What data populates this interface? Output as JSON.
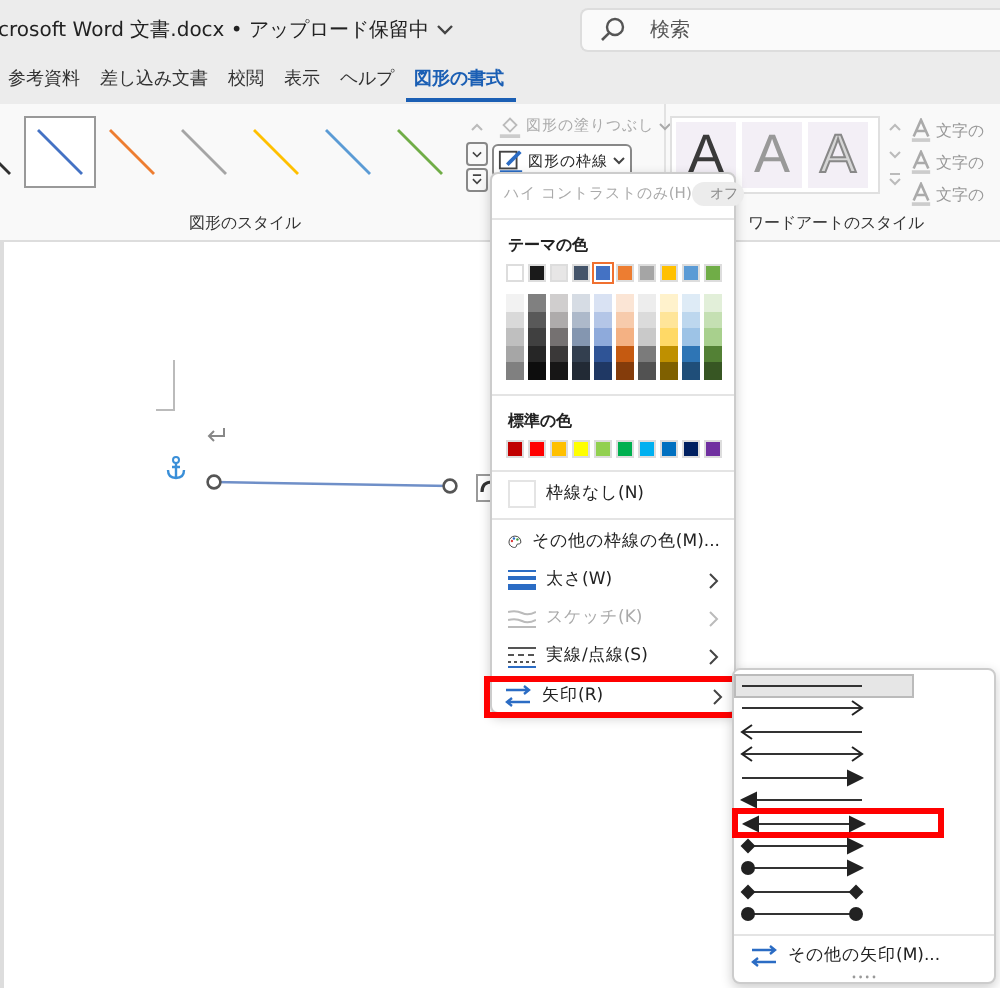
{
  "title_bar": {
    "document_title": "crosoft Word 文書.docx • アップロード保留中",
    "search": {
      "placeholder": "検索"
    }
  },
  "tabs": [
    {
      "label": "参考資料",
      "selected": false
    },
    {
      "label": "差し込み文書",
      "selected": false
    },
    {
      "label": "校閲",
      "selected": false
    },
    {
      "label": "表示",
      "selected": false
    },
    {
      "label": "ヘルプ",
      "selected": false
    },
    {
      "label": "図形の書式",
      "selected": true
    }
  ],
  "ribbon": {
    "shape_styles": {
      "label": "図形のスタイル",
      "styles": [
        {
          "color": "#303030",
          "selected": false
        },
        {
          "color": "#4472c4",
          "selected": true
        },
        {
          "color": "#ed7d31",
          "selected": false
        },
        {
          "color": "#a5a5a5",
          "selected": false
        },
        {
          "color": "#ffc000",
          "selected": false
        },
        {
          "color": "#5b9bd5",
          "selected": false
        },
        {
          "color": "#70ad47",
          "selected": false
        }
      ]
    },
    "fill_button": {
      "label": "図形の塗りつぶし",
      "disabled": true
    },
    "outline_button": {
      "label": "図形の枠線",
      "expanded": true
    },
    "wordart": {
      "label": "ワードアートのスタイル",
      "styles": [
        {
          "text": "A",
          "kind": "solid"
        },
        {
          "text": "A",
          "kind": "gray"
        },
        {
          "text": "A",
          "kind": "outline"
        }
      ]
    },
    "text_buttons": [
      {
        "label": "文字の"
      },
      {
        "label": "文字の"
      },
      {
        "label": "文字の"
      }
    ]
  },
  "outline_menu": {
    "high_contrast": {
      "label": "ハイ コントラストのみ(H)",
      "toggle": "オフ",
      "disabled": true
    },
    "theme_colors": {
      "label": "テーマの色",
      "colors": [
        {
          "color": "#ffffff",
          "selected": false,
          "shades": [
            {
              "color": "#f2f2f2"
            },
            {
              "color": "#d9d9d9"
            },
            {
              "color": "#bfbfbf"
            },
            {
              "color": "#a6a6a6"
            },
            {
              "color": "#808080"
            }
          ]
        },
        {
          "color": "#1a1a1a",
          "selected": false,
          "shades": [
            {
              "color": "#808080"
            },
            {
              "color": "#595959"
            },
            {
              "color": "#404040"
            },
            {
              "color": "#262626"
            },
            {
              "color": "#0d0d0d"
            }
          ]
        },
        {
          "color": "#e7e6e6",
          "selected": false,
          "shades": [
            {
              "color": "#d0cece"
            },
            {
              "color": "#aeabab"
            },
            {
              "color": "#757171"
            },
            {
              "color": "#3a3838"
            },
            {
              "color": "#171616"
            }
          ]
        },
        {
          "color": "#44546a",
          "selected": false,
          "shades": [
            {
              "color": "#d6dce4"
            },
            {
              "color": "#adb9ca"
            },
            {
              "color": "#8496b0"
            },
            {
              "color": "#333f4f"
            },
            {
              "color": "#222a35"
            }
          ]
        },
        {
          "color": "#4472c4",
          "selected": true,
          "shades": [
            {
              "color": "#d9e2f3"
            },
            {
              "color": "#b4c6e7"
            },
            {
              "color": "#8eaadb"
            },
            {
              "color": "#2f5496"
            },
            {
              "color": "#1f3864"
            }
          ]
        },
        {
          "color": "#ed7d31",
          "selected": false,
          "shades": [
            {
              "color": "#fbe5d5"
            },
            {
              "color": "#f7cbac"
            },
            {
              "color": "#f4b183"
            },
            {
              "color": "#c55a11"
            },
            {
              "color": "#843c0b"
            }
          ]
        },
        {
          "color": "#a5a5a5",
          "selected": false,
          "shades": [
            {
              "color": "#ededed"
            },
            {
              "color": "#dbdbdb"
            },
            {
              "color": "#c9c9c9"
            },
            {
              "color": "#7b7b7b"
            },
            {
              "color": "#525252"
            }
          ]
        },
        {
          "color": "#ffc000",
          "selected": false,
          "shades": [
            {
              "color": "#fff2cc"
            },
            {
              "color": "#ffe599"
            },
            {
              "color": "#ffd966"
            },
            {
              "color": "#bf9000"
            },
            {
              "color": "#7f6000"
            }
          ]
        },
        {
          "color": "#5b9bd5",
          "selected": false,
          "shades": [
            {
              "color": "#deebf6"
            },
            {
              "color": "#bdd7ee"
            },
            {
              "color": "#9dc3e6"
            },
            {
              "color": "#2e75b5"
            },
            {
              "color": "#1f4e79"
            }
          ]
        },
        {
          "color": "#70ad47",
          "selected": false,
          "shades": [
            {
              "color": "#e2efd9"
            },
            {
              "color": "#c5e0b3"
            },
            {
              "color": "#a8d08d"
            },
            {
              "color": "#538135"
            },
            {
              "color": "#375623"
            }
          ]
        }
      ]
    },
    "standard_colors": {
      "label": "標準の色",
      "colors": [
        {
          "color": "#c00000"
        },
        {
          "color": "#ff0000"
        },
        {
          "color": "#ffc000"
        },
        {
          "color": "#ffff00"
        },
        {
          "color": "#92d050"
        },
        {
          "color": "#00b050"
        },
        {
          "color": "#00b0f0"
        },
        {
          "color": "#0070c0"
        },
        {
          "color": "#002060"
        },
        {
          "color": "#7030a0"
        }
      ]
    },
    "items": [
      {
        "label": "枠線なし(N)",
        "kind": "none",
        "disabled": false,
        "submenu": false,
        "highlighted": false
      },
      {
        "label": "その他の枠線の色(M)...",
        "kind": "palette",
        "disabled": false,
        "submenu": false,
        "highlighted": false
      },
      {
        "label": "太さ(W)",
        "kind": "weight",
        "disabled": false,
        "submenu": true,
        "highlighted": false
      },
      {
        "label": "スケッチ(K)",
        "kind": "sketch",
        "disabled": true,
        "submenu": true,
        "highlighted": false
      },
      {
        "label": "実線/点線(S)",
        "kind": "dash",
        "disabled": false,
        "submenu": true,
        "highlighted": false
      },
      {
        "label": "矢印(R)",
        "kind": "arrows",
        "disabled": false,
        "submenu": true,
        "highlighted": true
      }
    ]
  },
  "arrow_submenu": {
    "arrows": [
      {
        "start": {
          "kind": "none"
        },
        "end": {
          "kind": "none"
        },
        "selected": true,
        "highlighted": false
      },
      {
        "start": {
          "kind": "none"
        },
        "end": {
          "kind": "open"
        },
        "selected": false,
        "highlighted": false
      },
      {
        "start": {
          "kind": "open"
        },
        "end": {
          "kind": "none"
        },
        "selected": false,
        "highlighted": false
      },
      {
        "start": {
          "kind": "open"
        },
        "end": {
          "kind": "open"
        },
        "selected": false,
        "highlighted": false
      },
      {
        "start": {
          "kind": "none"
        },
        "end": {
          "kind": "triangle"
        },
        "selected": false,
        "highlighted": false
      },
      {
        "start": {
          "kind": "triangle"
        },
        "end": {
          "kind": "none"
        },
        "selected": false,
        "highlighted": false
      },
      {
        "start": {
          "kind": "triangle"
        },
        "end": {
          "kind": "triangle"
        },
        "selected": false,
        "highlighted": true
      },
      {
        "start": {
          "kind": "diamond"
        },
        "end": {
          "kind": "triangle"
        },
        "selected": false,
        "highlighted": false
      },
      {
        "start": {
          "kind": "dot"
        },
        "end": {
          "kind": "triangle"
        },
        "selected": false,
        "highlighted": false
      },
      {
        "start": {
          "kind": "diamond"
        },
        "end": {
          "kind": "diamond"
        },
        "selected": false,
        "highlighted": false
      },
      {
        "start": {
          "kind": "dot"
        },
        "end": {
          "kind": "dot"
        },
        "selected": false,
        "highlighted": false
      }
    ],
    "more": {
      "label": "その他の矢印(M)..."
    }
  }
}
